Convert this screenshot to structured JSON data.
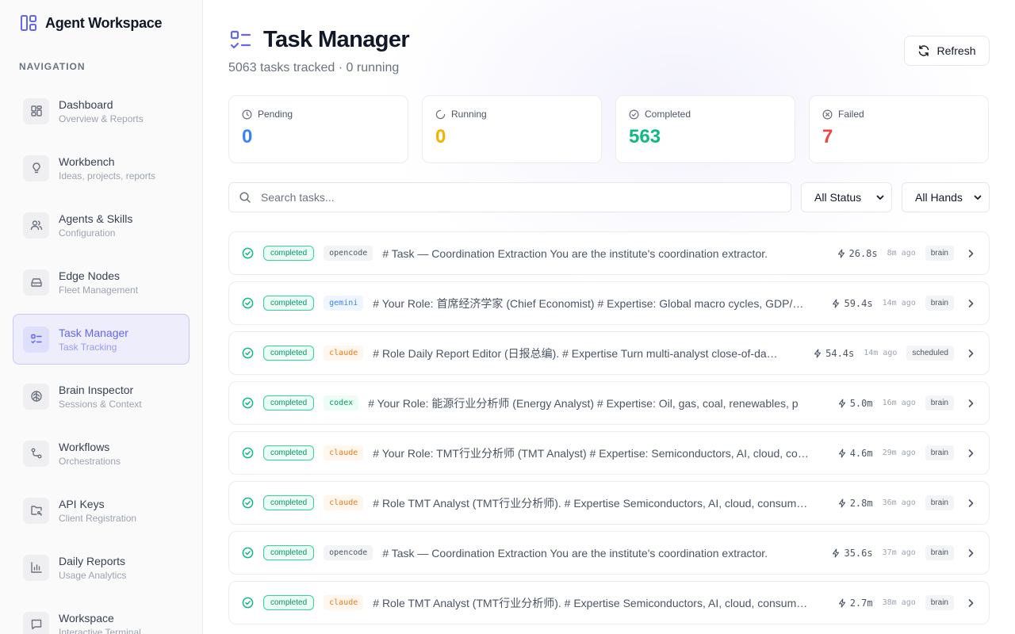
{
  "app": {
    "title": "Agent Workspace"
  },
  "sidebar": {
    "heading": "NAVIGATION",
    "items": [
      {
        "label": "Dashboard",
        "sub": "Overview & Reports",
        "icon": "dashboard-icon",
        "active": false
      },
      {
        "label": "Workbench",
        "sub": "Ideas, projects, reports",
        "icon": "lightbulb-icon",
        "active": false
      },
      {
        "label": "Agents & Skills",
        "sub": "Configuration",
        "icon": "users-icon",
        "active": false
      },
      {
        "label": "Edge Nodes",
        "sub": "Fleet Management",
        "icon": "hard-drive-icon",
        "active": false
      },
      {
        "label": "Task Manager",
        "sub": "Task Tracking",
        "icon": "list-checks-icon",
        "active": true
      },
      {
        "label": "Brain Inspector",
        "sub": "Sessions & Context",
        "icon": "brain-icon",
        "active": false
      },
      {
        "label": "Workflows",
        "sub": "Orchestrations",
        "icon": "workflow-icon",
        "active": false
      },
      {
        "label": "API Keys",
        "sub": "Client Registration",
        "icon": "folder-key-icon",
        "active": false
      },
      {
        "label": "Daily Reports",
        "sub": "Usage Analytics",
        "icon": "bar-chart-icon",
        "active": false
      },
      {
        "label": "Workspace",
        "sub": "Interactive Terminal",
        "icon": "message-square-icon",
        "active": false
      }
    ]
  },
  "header": {
    "title": "Task Manager",
    "subtitle": "5063 tasks tracked · 0 running",
    "refresh_label": "Refresh"
  },
  "stats": [
    {
      "label": "Pending",
      "value": "0",
      "color": "#3b82f6",
      "icon": "clock-icon"
    },
    {
      "label": "Running",
      "value": "0",
      "color": "#f5b301",
      "icon": "loader-icon"
    },
    {
      "label": "Completed",
      "value": "563",
      "color": "#10b981",
      "icon": "check-circle-icon"
    },
    {
      "label": "Failed",
      "value": "7",
      "color": "#ef4444",
      "icon": "x-circle-icon"
    }
  ],
  "filters": {
    "search_placeholder": "Search tasks...",
    "status_select": "All Status",
    "hands_select": "All Hands"
  },
  "tasks": [
    {
      "status": "completed",
      "hand": "opencode",
      "text": "# Task — Coordination Extraction You are the institute's coordination extractor.",
      "duration": "26.8s",
      "ago": "8m ago",
      "tag": "brain"
    },
    {
      "status": "completed",
      "hand": "gemini",
      "text": "# Your Role: 首席经济学家 (Chief Economist) # Expertise: Global macro cycles, GDP/…",
      "duration": "59.4s",
      "ago": "14m ago",
      "tag": "brain"
    },
    {
      "status": "completed",
      "hand": "claude",
      "text": "# Role Daily Report Editor (日报总编). # Expertise Turn multi-analyst close-of-da…",
      "duration": "54.4s",
      "ago": "14m ago",
      "tag": "scheduled"
    },
    {
      "status": "completed",
      "hand": "codex",
      "text": "# Your Role: 能源行业分析师 (Energy Analyst) # Expertise: Oil, gas, coal, renewables, p",
      "duration": "5.0m",
      "ago": "16m ago",
      "tag": "brain"
    },
    {
      "status": "completed",
      "hand": "claude",
      "text": "# Your Role: TMT行业分析师 (TMT Analyst) # Expertise: Semiconductors, AI, cloud, co…",
      "duration": "4.6m",
      "ago": "29m ago",
      "tag": "brain"
    },
    {
      "status": "completed",
      "hand": "claude",
      "text": "# Role TMT Analyst (TMT行业分析师). # Expertise Semiconductors, AI, cloud, consum…",
      "duration": "2.8m",
      "ago": "36m ago",
      "tag": "brain"
    },
    {
      "status": "completed",
      "hand": "opencode",
      "text": "# Task — Coordination Extraction You are the institute's coordination extractor.",
      "duration": "35.6s",
      "ago": "37m ago",
      "tag": "brain"
    },
    {
      "status": "completed",
      "hand": "claude",
      "text": "# Role TMT Analyst (TMT行业分析师). # Expertise Semiconductors, AI, cloud, consum…",
      "duration": "2.7m",
      "ago": "38m ago",
      "tag": "brain"
    }
  ]
}
